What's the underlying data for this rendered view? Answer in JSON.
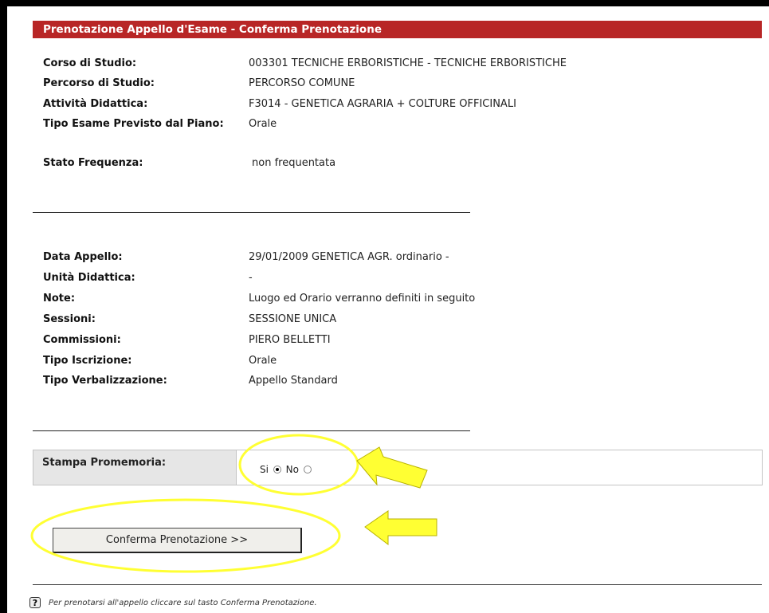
{
  "header": {
    "title": "Prenotazione Appello d'Esame - Conferma Prenotazione"
  },
  "course_info": [
    {
      "label": "Corso di Studio:",
      "value": "003301 TECNICHE ERBORISTICHE - TECNICHE ERBORISTICHE"
    },
    {
      "label": "Percorso di Studio:",
      "value": "PERCORSO COMUNE"
    },
    {
      "label": "Attività Didattica:",
      "value": "F3014 - GENETICA AGRARIA + COLTURE OFFICINALI"
    },
    {
      "label": "Tipo Esame Previsto dal Piano:",
      "value": "Orale"
    },
    {
      "label": "Stato Frequenza:",
      "value": "non frequentata"
    }
  ],
  "exam_info": [
    {
      "label": "Data Appello:",
      "value": "29/01/2009 GENETICA AGR. ordinario -"
    },
    {
      "label": "Unità Didattica:",
      "value": "-"
    },
    {
      "label": "Note:",
      "value": "Luogo ed Orario verranno definiti in seguito"
    },
    {
      "label": "Sessioni:",
      "value": "SESSIONE UNICA"
    },
    {
      "label": "Commissioni:",
      "value": "PIERO BELLETTI"
    },
    {
      "label": "Tipo Iscrizione:",
      "value": "Orale"
    },
    {
      "label": "Tipo Verbalizzazione:",
      "value": "Appello Standard"
    }
  ],
  "stampa": {
    "label": "Stampa Promemoria:",
    "option_si": "Si",
    "option_no": "No",
    "selected": "Si"
  },
  "confirm_button": {
    "label": "Conferma Prenotazione >>"
  },
  "help": {
    "icon": "help-icon",
    "text": "Per prenotarsi all'appello cliccare sul tasto Conferma Prenotazione."
  },
  "colors": {
    "header_bg": "#b82626",
    "annotation_yellow": "#ffff33"
  }
}
